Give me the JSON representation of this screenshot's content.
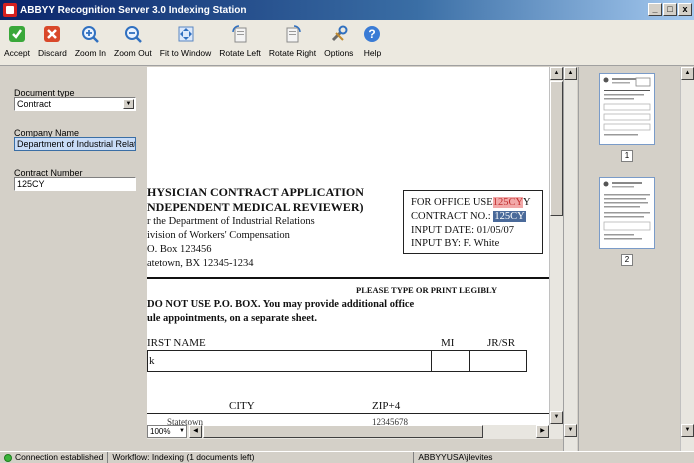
{
  "window": {
    "title": "ABBYY Recognition Server 3.0 Indexing Station",
    "buttons": [
      "_",
      "□",
      "x"
    ]
  },
  "toolbar": {
    "buttons": [
      {
        "label": "Accept",
        "icon": "accept-icon"
      },
      {
        "label": "Discard",
        "icon": "discard-icon"
      },
      {
        "label": "Zoom In",
        "icon": "zoom-in-icon"
      },
      {
        "label": "Zoom Out",
        "icon": "zoom-out-icon"
      },
      {
        "label": "Fit to Window",
        "icon": "fit-to-window-icon"
      },
      {
        "label": "Rotate Left",
        "icon": "rotate-left-icon"
      },
      {
        "label": "Rotate Right",
        "icon": "rotate-right-icon"
      },
      {
        "label": "Options",
        "icon": "options-icon"
      },
      {
        "label": "Help",
        "icon": "help-icon"
      }
    ]
  },
  "fields": {
    "document_type": {
      "label": "Document type",
      "value": "Contract"
    },
    "company_name": {
      "label": "Company Name",
      "value": "Department of Industrial Relatio"
    },
    "contract_number": {
      "label": "Contract Number",
      "value": "125CY"
    }
  },
  "document": {
    "heading1": "HYSICIAN CONTRACT APPLICATION",
    "heading2": "NDEPENDENT MEDICAL REVIEWER)",
    "addr1": "r the Department of Industrial Relations",
    "addr2": "ivision of Workers' Compensation",
    "addr3": "O. Box 123456",
    "addr4": "atetown, BX 12345-1234",
    "office_use": "FOR OFFICE USE",
    "office_use_stamp": "125CY",
    "office_use_tail": "Y",
    "contract_no_label": "CONTRACT NO.:",
    "contract_no_value": "125CY",
    "input_date": "INPUT DATE:  01/05/07",
    "input_by": "INPUT BY:  F. White",
    "please_type": "PLEASE TYPE OR PRINT LEGIBLY",
    "warning1": "DO NOT USE P.O. BOX. You may provide additional office",
    "warning2": "ule appointments, on a separate sheet.",
    "first_name": "IRST NAME",
    "mi": "MI",
    "jr_sr": "JR/SR",
    "name_value": "k",
    "city": "CITY",
    "zip": "ZIP+4",
    "city_value": "Statetown",
    "zip_value": "12345678"
  },
  "zoom": {
    "value": "100%"
  },
  "thumbnails": {
    "pages": [
      "1",
      "2"
    ]
  },
  "status": {
    "connection": "Connection established",
    "workflow": "Workflow: Indexing (1 documents left)",
    "user": "ABBYYUSA\\jlevites"
  }
}
